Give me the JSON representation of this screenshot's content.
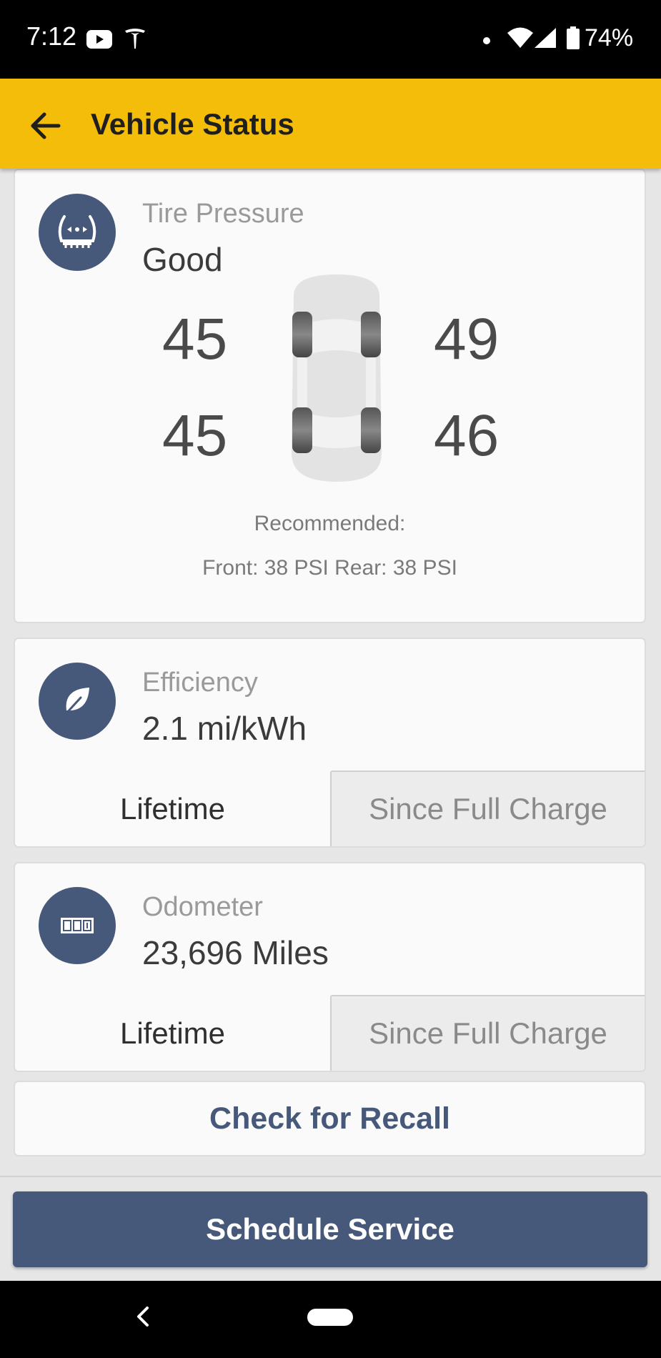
{
  "status_bar": {
    "time": "7:12",
    "battery": "74%",
    "icons": [
      "youtube-icon",
      "tesla-icon",
      "notification-dot-icon",
      "wifi-icon",
      "cell-signal-icon",
      "battery-icon"
    ]
  },
  "app_bar": {
    "title": "Vehicle Status",
    "back_icon": "arrow-left-icon"
  },
  "tire": {
    "icon": "tire-pressure-icon",
    "label": "Tire Pressure",
    "status": "Good",
    "front_left": "45",
    "front_right": "49",
    "rear_left": "45",
    "rear_right": "46",
    "recommended_title": "Recommended:",
    "recommended_values": "Front: 38 PSI Rear: 38 PSI"
  },
  "efficiency": {
    "icon": "leaf-icon",
    "label": "Efficiency",
    "value": "2.1 mi/kWh",
    "tabs": [
      "Lifetime",
      "Since Full Charge"
    ],
    "selected_tab": "Lifetime"
  },
  "odometer": {
    "icon": "odometer-icon",
    "label": "Odometer",
    "value": "23,696 Miles",
    "tabs": [
      "Lifetime",
      "Since Full Charge"
    ],
    "selected_tab": "Lifetime"
  },
  "recall": {
    "label": "Check for Recall"
  },
  "schedule": {
    "label": "Schedule Service"
  },
  "colors": {
    "app_bar": "#f3bd09",
    "accent": "#46597a",
    "background": "#e6e6e6"
  },
  "nav_bar": {
    "icons": [
      "nav-back-icon",
      "home-pill-icon"
    ]
  }
}
